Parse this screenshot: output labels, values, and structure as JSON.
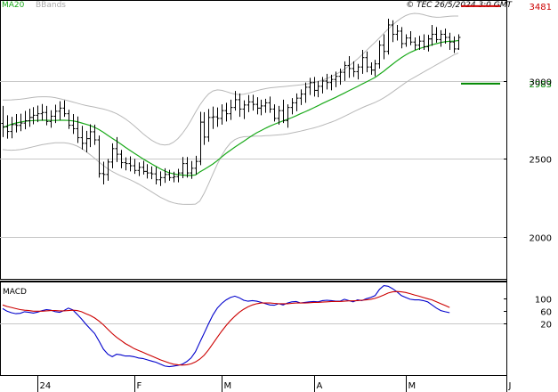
{
  "header": {
    "legend_ma": "MA20",
    "legend_bb": "BBands",
    "copyright": "© TEC 26/5/2024 3:0 GMT"
  },
  "colors": {
    "price_bars": "#000000",
    "ma20": "#1aaa1a",
    "bbands": "#b8b8b8",
    "resistance": "#cc0000",
    "support": "#008800",
    "macd_line": "#0000cc",
    "signal_line": "#cc0000",
    "grid": "#c8c8c8",
    "axis": "#000000"
  },
  "chart_data": [
    {
      "type": "ohlc",
      "panel": "price",
      "y_ticks": [
        "3000",
        "2500",
        "2000"
      ],
      "y_tick_values": [
        3000,
        2500,
        2000
      ],
      "ylim": [
        1730,
        3520
      ],
      "legend": [
        "MA20",
        "BBands"
      ],
      "levels": [
        {
          "label": "3481",
          "value": 3481,
          "kind": "resistance"
        },
        {
          "label": "2983",
          "value": 2983,
          "kind": "support"
        }
      ],
      "bars": [
        [
          2728,
          2840,
          2640,
          2706
        ],
        [
          2706,
          2780,
          2630,
          2676
        ],
        [
          2676,
          2770,
          2632,
          2720
        ],
        [
          2720,
          2788,
          2670,
          2715
        ],
        [
          2715,
          2790,
          2678,
          2730
        ],
        [
          2730,
          2808,
          2690,
          2745
        ],
        [
          2745,
          2822,
          2706,
          2766
        ],
        [
          2766,
          2832,
          2722,
          2780
        ],
        [
          2780,
          2842,
          2736,
          2790
        ],
        [
          2790,
          2852,
          2746,
          2798
        ],
        [
          2798,
          2840,
          2716,
          2740
        ],
        [
          2740,
          2812,
          2700,
          2774
        ],
        [
          2774,
          2848,
          2730,
          2806
        ],
        [
          2806,
          2870,
          2750,
          2826
        ],
        [
          2826,
          2876,
          2770,
          2790
        ],
        [
          2790,
          2816,
          2692,
          2716
        ],
        [
          2716,
          2788,
          2660,
          2694
        ],
        [
          2694,
          2772,
          2602,
          2636
        ],
        [
          2636,
          2712,
          2560,
          2600
        ],
        [
          2600,
          2680,
          2542,
          2630
        ],
        [
          2630,
          2722,
          2576,
          2674
        ],
        [
          2674,
          2720,
          2590,
          2622
        ],
        [
          2622,
          2650,
          2380,
          2406
        ],
        [
          2406,
          2482,
          2336,
          2400
        ],
        [
          2400,
          2500,
          2360,
          2480
        ],
        [
          2480,
          2600,
          2440,
          2566
        ],
        [
          2566,
          2640,
          2480,
          2530
        ],
        [
          2530,
          2558,
          2440,
          2476
        ],
        [
          2476,
          2510,
          2426,
          2470
        ],
        [
          2470,
          2516,
          2420,
          2456
        ],
        [
          2456,
          2500,
          2404,
          2426
        ],
        [
          2426,
          2478,
          2390,
          2446
        ],
        [
          2446,
          2488,
          2400,
          2420
        ],
        [
          2420,
          2466,
          2374,
          2410
        ],
        [
          2410,
          2452,
          2370,
          2404
        ],
        [
          2404,
          2448,
          2336,
          2366
        ],
        [
          2366,
          2420,
          2326,
          2380
        ],
        [
          2380,
          2440,
          2346,
          2400
        ],
        [
          2400,
          2430,
          2360,
          2380
        ],
        [
          2380,
          2418,
          2350,
          2386
        ],
        [
          2386,
          2436,
          2350,
          2410
        ],
        [
          2410,
          2512,
          2376,
          2470
        ],
        [
          2470,
          2512,
          2380,
          2410
        ],
        [
          2410,
          2486,
          2372,
          2440
        ],
        [
          2440,
          2520,
          2400,
          2484
        ],
        [
          2484,
          2802,
          2460,
          2736
        ],
        [
          2736,
          2800,
          2590,
          2640
        ],
        [
          2640,
          2820,
          2610,
          2766
        ],
        [
          2766,
          2836,
          2692,
          2770
        ],
        [
          2770,
          2830,
          2706,
          2760
        ],
        [
          2760,
          2850,
          2720,
          2810
        ],
        [
          2810,
          2860,
          2740,
          2790
        ],
        [
          2790,
          2880,
          2750,
          2830
        ],
        [
          2830,
          2936,
          2810,
          2880
        ],
        [
          2880,
          2920,
          2770,
          2820
        ],
        [
          2820,
          2876,
          2756,
          2846
        ],
        [
          2846,
          2910,
          2800,
          2866
        ],
        [
          2866,
          2912,
          2810,
          2850
        ],
        [
          2850,
          2896,
          2786,
          2826
        ],
        [
          2826,
          2880,
          2780,
          2840
        ],
        [
          2840,
          2886,
          2796,
          2860
        ],
        [
          2860,
          2900,
          2796,
          2820
        ],
        [
          2820,
          2850,
          2740,
          2760
        ],
        [
          2760,
          2840,
          2720,
          2810
        ],
        [
          2810,
          2880,
          2730,
          2746
        ],
        [
          2746,
          2850,
          2700,
          2830
        ],
        [
          2830,
          2890,
          2786,
          2860
        ],
        [
          2860,
          2920,
          2806,
          2890
        ],
        [
          2890,
          2946,
          2846,
          2916
        ],
        [
          2916,
          2990,
          2860,
          2960
        ],
        [
          2960,
          3020,
          2910,
          2990
        ],
        [
          2990,
          3026,
          2900,
          2940
        ],
        [
          2940,
          3000,
          2896,
          2966
        ],
        [
          2966,
          3026,
          2920,
          3000
        ],
        [
          3000,
          3046,
          2946,
          2990
        ],
        [
          2990,
          3040,
          2940,
          3010
        ],
        [
          3010,
          3060,
          2960,
          3030
        ],
        [
          3030,
          3080,
          2976,
          3056
        ],
        [
          3056,
          3126,
          3000,
          3100
        ],
        [
          3100,
          3160,
          3020,
          3080
        ],
        [
          3080,
          3126,
          3026,
          3060
        ],
        [
          3060,
          3110,
          3010,
          3090
        ],
        [
          3090,
          3200,
          3046,
          3150
        ],
        [
          3150,
          3190,
          3056,
          3090
        ],
        [
          3090,
          3120,
          3040,
          3070
        ],
        [
          3070,
          3136,
          3030,
          3110
        ],
        [
          3110,
          3260,
          3080,
          3230
        ],
        [
          3230,
          3300,
          3140,
          3190
        ],
        [
          3190,
          3400,
          3170,
          3360
        ],
        [
          3360,
          3390,
          3250,
          3300
        ],
        [
          3300,
          3360,
          3260,
          3320
        ],
        [
          3320,
          3346,
          3210,
          3240
        ],
        [
          3240,
          3300,
          3220,
          3276
        ],
        [
          3276,
          3320,
          3230,
          3250
        ],
        [
          3250,
          3280,
          3200,
          3230
        ],
        [
          3230,
          3290,
          3200,
          3256
        ],
        [
          3256,
          3300,
          3200,
          3220
        ],
        [
          3220,
          3296,
          3190,
          3270
        ],
        [
          3270,
          3360,
          3226,
          3300
        ],
        [
          3300,
          3346,
          3246,
          3266
        ],
        [
          3266,
          3326,
          3220,
          3300
        ],
        [
          3300,
          3336,
          3240,
          3280
        ],
        [
          3280,
          3310,
          3200,
          3250
        ],
        [
          3250,
          3286,
          3180,
          3206
        ],
        [
          3206,
          3300,
          3200,
          3280
        ]
      ],
      "ma20": [
        2700,
        2712,
        2722,
        2730,
        2736,
        2741,
        2744,
        2746,
        2747,
        2748,
        2748,
        2747,
        2747,
        2748,
        2748,
        2747,
        2744,
        2739,
        2731,
        2723,
        2714,
        2702,
        2688,
        2671,
        2651,
        2632,
        2614,
        2595,
        2575,
        2556,
        2537,
        2519,
        2501,
        2484,
        2468,
        2452,
        2436,
        2422,
        2411,
        2404,
        2399,
        2396,
        2394,
        2394,
        2397,
        2416,
        2433,
        2450,
        2468,
        2489,
        2513,
        2536,
        2556,
        2576,
        2594,
        2613,
        2632,
        2651,
        2668,
        2682,
        2697,
        2710,
        2722,
        2733,
        2744,
        2754,
        2765,
        2777,
        2790,
        2802,
        2815,
        2828,
        2842,
        2856,
        2869,
        2882,
        2895,
        2909,
        2923,
        2937,
        2951,
        2965,
        2980,
        2994,
        3008,
        3023,
        3043,
        3063,
        3086,
        3108,
        3130,
        3150,
        3168,
        3183,
        3196,
        3207,
        3216,
        3224,
        3233,
        3240,
        3247,
        3252,
        3255,
        3256,
        3260
      ],
      "bb_upper": [
        2878,
        2878,
        2879,
        2881,
        2883,
        2887,
        2891,
        2895,
        2898,
        2899,
        2899,
        2897,
        2893,
        2887,
        2880,
        2873,
        2865,
        2858,
        2850,
        2843,
        2837,
        2832,
        2826,
        2820,
        2812,
        2802,
        2790,
        2775,
        2757,
        2736,
        2713,
        2688,
        2663,
        2640,
        2620,
        2604,
        2593,
        2589,
        2593,
        2607,
        2630,
        2662,
        2702,
        2748,
        2799,
        2845,
        2886,
        2917,
        2936,
        2943,
        2940,
        2932,
        2923,
        2916,
        2913,
        2915,
        2921,
        2929,
        2938,
        2945,
        2951,
        2956,
        2959,
        2962,
        2964,
        2967,
        2969,
        2972,
        2975,
        2979,
        2984,
        2990,
        2997,
        3006,
        3016,
        3028,
        3042,
        3058,
        3076,
        3096,
        3118,
        3142,
        3168,
        3195,
        3222,
        3249,
        3277,
        3306,
        3334,
        3360,
        3384,
        3404,
        3420,
        3430,
        3434,
        3432,
        3426,
        3418,
        3412,
        3409,
        3410,
        3413,
        3416,
        3417,
        3417
      ],
      "bb_lower": [
        2560,
        2557,
        2556,
        2557,
        2560,
        2565,
        2571,
        2578,
        2585,
        2591,
        2596,
        2600,
        2603,
        2604,
        2603,
        2600,
        2593,
        2582,
        2567,
        2548,
        2526,
        2503,
        2480,
        2457,
        2437,
        2419,
        2404,
        2391,
        2379,
        2367,
        2354,
        2339,
        2323,
        2306,
        2289,
        2271,
        2254,
        2240,
        2227,
        2218,
        2212,
        2209,
        2208,
        2208,
        2210,
        2230,
        2280,
        2340,
        2404,
        2466,
        2522,
        2568,
        2602,
        2624,
        2636,
        2642,
        2644,
        2645,
        2646,
        2647,
        2649,
        2650,
        2652,
        2654,
        2657,
        2661,
        2666,
        2672,
        2678,
        2685,
        2692,
        2699,
        2707,
        2716,
        2726,
        2736,
        2747,
        2760,
        2773,
        2787,
        2801,
        2815,
        2828,
        2840,
        2851,
        2863,
        2876,
        2892,
        2910,
        2930,
        2950,
        2970,
        2990,
        3008,
        3024,
        3040,
        3056,
        3072,
        3088,
        3104,
        3120,
        3136,
        3152,
        3168,
        3180
      ],
      "x_labels": [
        {
          "label": "24",
          "index": 8
        },
        {
          "label": "F",
          "index": 30
        },
        {
          "label": "M",
          "index": 50
        },
        {
          "label": "A",
          "index": 71
        },
        {
          "label": "M",
          "index": 92
        },
        {
          "label": "J",
          "index": 115
        }
      ]
    },
    {
      "type": "line",
      "panel": "macd",
      "title": "MACD",
      "y_ticks": [
        "100",
        "60",
        "20"
      ],
      "y_tick_values": [
        100,
        60,
        20
      ],
      "ylim": [
        -145,
        155
      ],
      "series": [
        {
          "values": [
            68,
            60,
            55,
            52,
            53,
            58,
            56,
            54,
            57,
            62,
            65,
            63,
            58,
            56,
            62,
            70,
            64,
            50,
            35,
            18,
            3,
            -12,
            -36,
            -62,
            -78,
            -86,
            -78,
            -80,
            -84,
            -84,
            -86,
            -90,
            -92,
            -96,
            -100,
            -104,
            -110,
            -116,
            -118,
            -116,
            -114,
            -110,
            -102,
            -90,
            -70,
            -40,
            -10,
            20,
            48,
            70,
            85,
            96,
            104,
            108,
            103,
            95,
            92,
            94,
            92,
            88,
            84,
            80,
            79,
            84,
            80,
            86,
            90,
            91,
            86,
            88,
            90,
            91,
            90,
            94,
            95,
            94,
            92,
            92,
            98,
            94,
            90,
            96,
            94,
            100,
            104,
            110,
            130,
            142,
            140,
            132,
            122,
            110,
            104,
            98,
            96,
            96,
            94,
            90,
            80,
            70,
            62,
            58,
            55
          ]
        },
        {
          "values": [
            80,
            75,
            72,
            68,
            65,
            63,
            62,
            60,
            60,
            60,
            61,
            62,
            62,
            61,
            61,
            62,
            63,
            62,
            58,
            52,
            46,
            38,
            28,
            16,
            2,
            -12,
            -24,
            -34,
            -44,
            -52,
            -60,
            -66,
            -72,
            -78,
            -84,
            -90,
            -96,
            -101,
            -106,
            -110,
            -112,
            -113,
            -112,
            -109,
            -103,
            -94,
            -81,
            -64,
            -44,
            -24,
            -4,
            14,
            30,
            44,
            56,
            66,
            74,
            80,
            84,
            86,
            86,
            86,
            85,
            84,
            84,
            84,
            85,
            86,
            86,
            86,
            87,
            88,
            88,
            89,
            90,
            91,
            91,
            91,
            92,
            93,
            93,
            94,
            95,
            96,
            98,
            101,
            106,
            112,
            118,
            122,
            123,
            122,
            120,
            116,
            112,
            108,
            104,
            100,
            96,
            90,
            84,
            78,
            72
          ]
        }
      ],
      "x_labels": [
        {
          "label": "24",
          "index": 8
        },
        {
          "label": "F",
          "index": 30
        },
        {
          "label": "M",
          "index": 50
        },
        {
          "label": "A",
          "index": 71
        },
        {
          "label": "M",
          "index": 92
        },
        {
          "label": "J",
          "index": 115
        }
      ]
    }
  ]
}
